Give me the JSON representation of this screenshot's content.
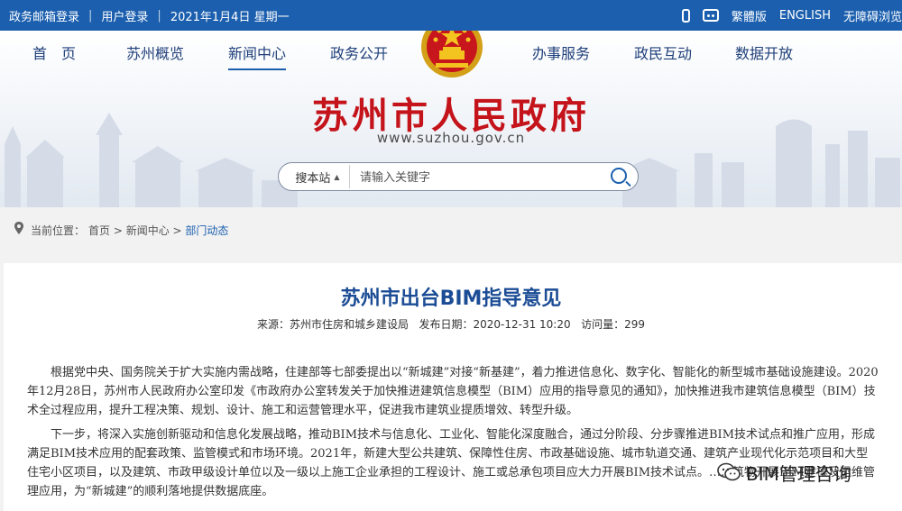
{
  "topbar": {
    "links": [
      "政务邮箱登录",
      "用户登录"
    ],
    "date": "2021年1月4日 星期一",
    "right": [
      "繁體版",
      "ENGLISH",
      "无障碍浏览"
    ]
  },
  "nav": {
    "items": [
      "首　页",
      "苏州概览",
      "新闻中心",
      "政务公开",
      "办事服务",
      "政民互动",
      "数据开放"
    ]
  },
  "header": {
    "title": "苏州市人民政府",
    "domain": "www.suzhou.gov.cn"
  },
  "search": {
    "scope": "搜本站",
    "placeholder": "请输入关键字"
  },
  "breadcrumb": {
    "label": "当前位置：",
    "items": [
      "首页",
      "新闻中心",
      "部门动态"
    ],
    "sep": " > "
  },
  "article": {
    "title": "苏州市出台BIM指导意见",
    "source_label": "来源：",
    "source": "苏州市住房和城乡建设局",
    "date_label": "发布日期：",
    "date": "2020-12-31 10:20",
    "views_label": "访问量：",
    "views": "299",
    "paragraphs": [
      "根据党中央、国务院关于扩大实施内需战略，住建部等七部委提出以“新城建”对接“新基建”，着力推进信息化、数字化、智能化的新型城市基础设施建设。2020年12月28日，苏州市人民政府办公室印发《市政府办公室转发关于加快推进建筑信息模型（BIM）应用的指导意见的通知》，加快推进我市建筑信息模型（BIM）技术全过程应用，提升工程决策、规划、设计、施工和运营管理水平，促进我市建筑业提质增效、转型升级。",
      "下一步，将深入实施创新驱动和信息化发展战略，推动BIM技术与信息化、工业化、智能化深度融合，通过分阶段、分步骤推进BIM技术试点和推广应用，形成满足BIM技术应用的配套政策、监管模式和市场环境。2021年，新建大型公共建筑、保障性住房、市政基础设施、城市轨道交通、建筑产业现代化示范项目和大型住宅小区项目，以及建筑、市政甲级设计单位以及一级以上施工企业承担的工程设计、施工或总承包项目应大力开展BIM技术试点。……筑物开展BIM建模及运维管理应用，为“新城建”的顺利落地提供数据底座。"
    ]
  },
  "watermark": {
    "text": "BIM管理咨询"
  },
  "colors": {
    "topbar": "#1b5fae",
    "title_red": "#c4131a",
    "article_title": "#1b4c95"
  }
}
